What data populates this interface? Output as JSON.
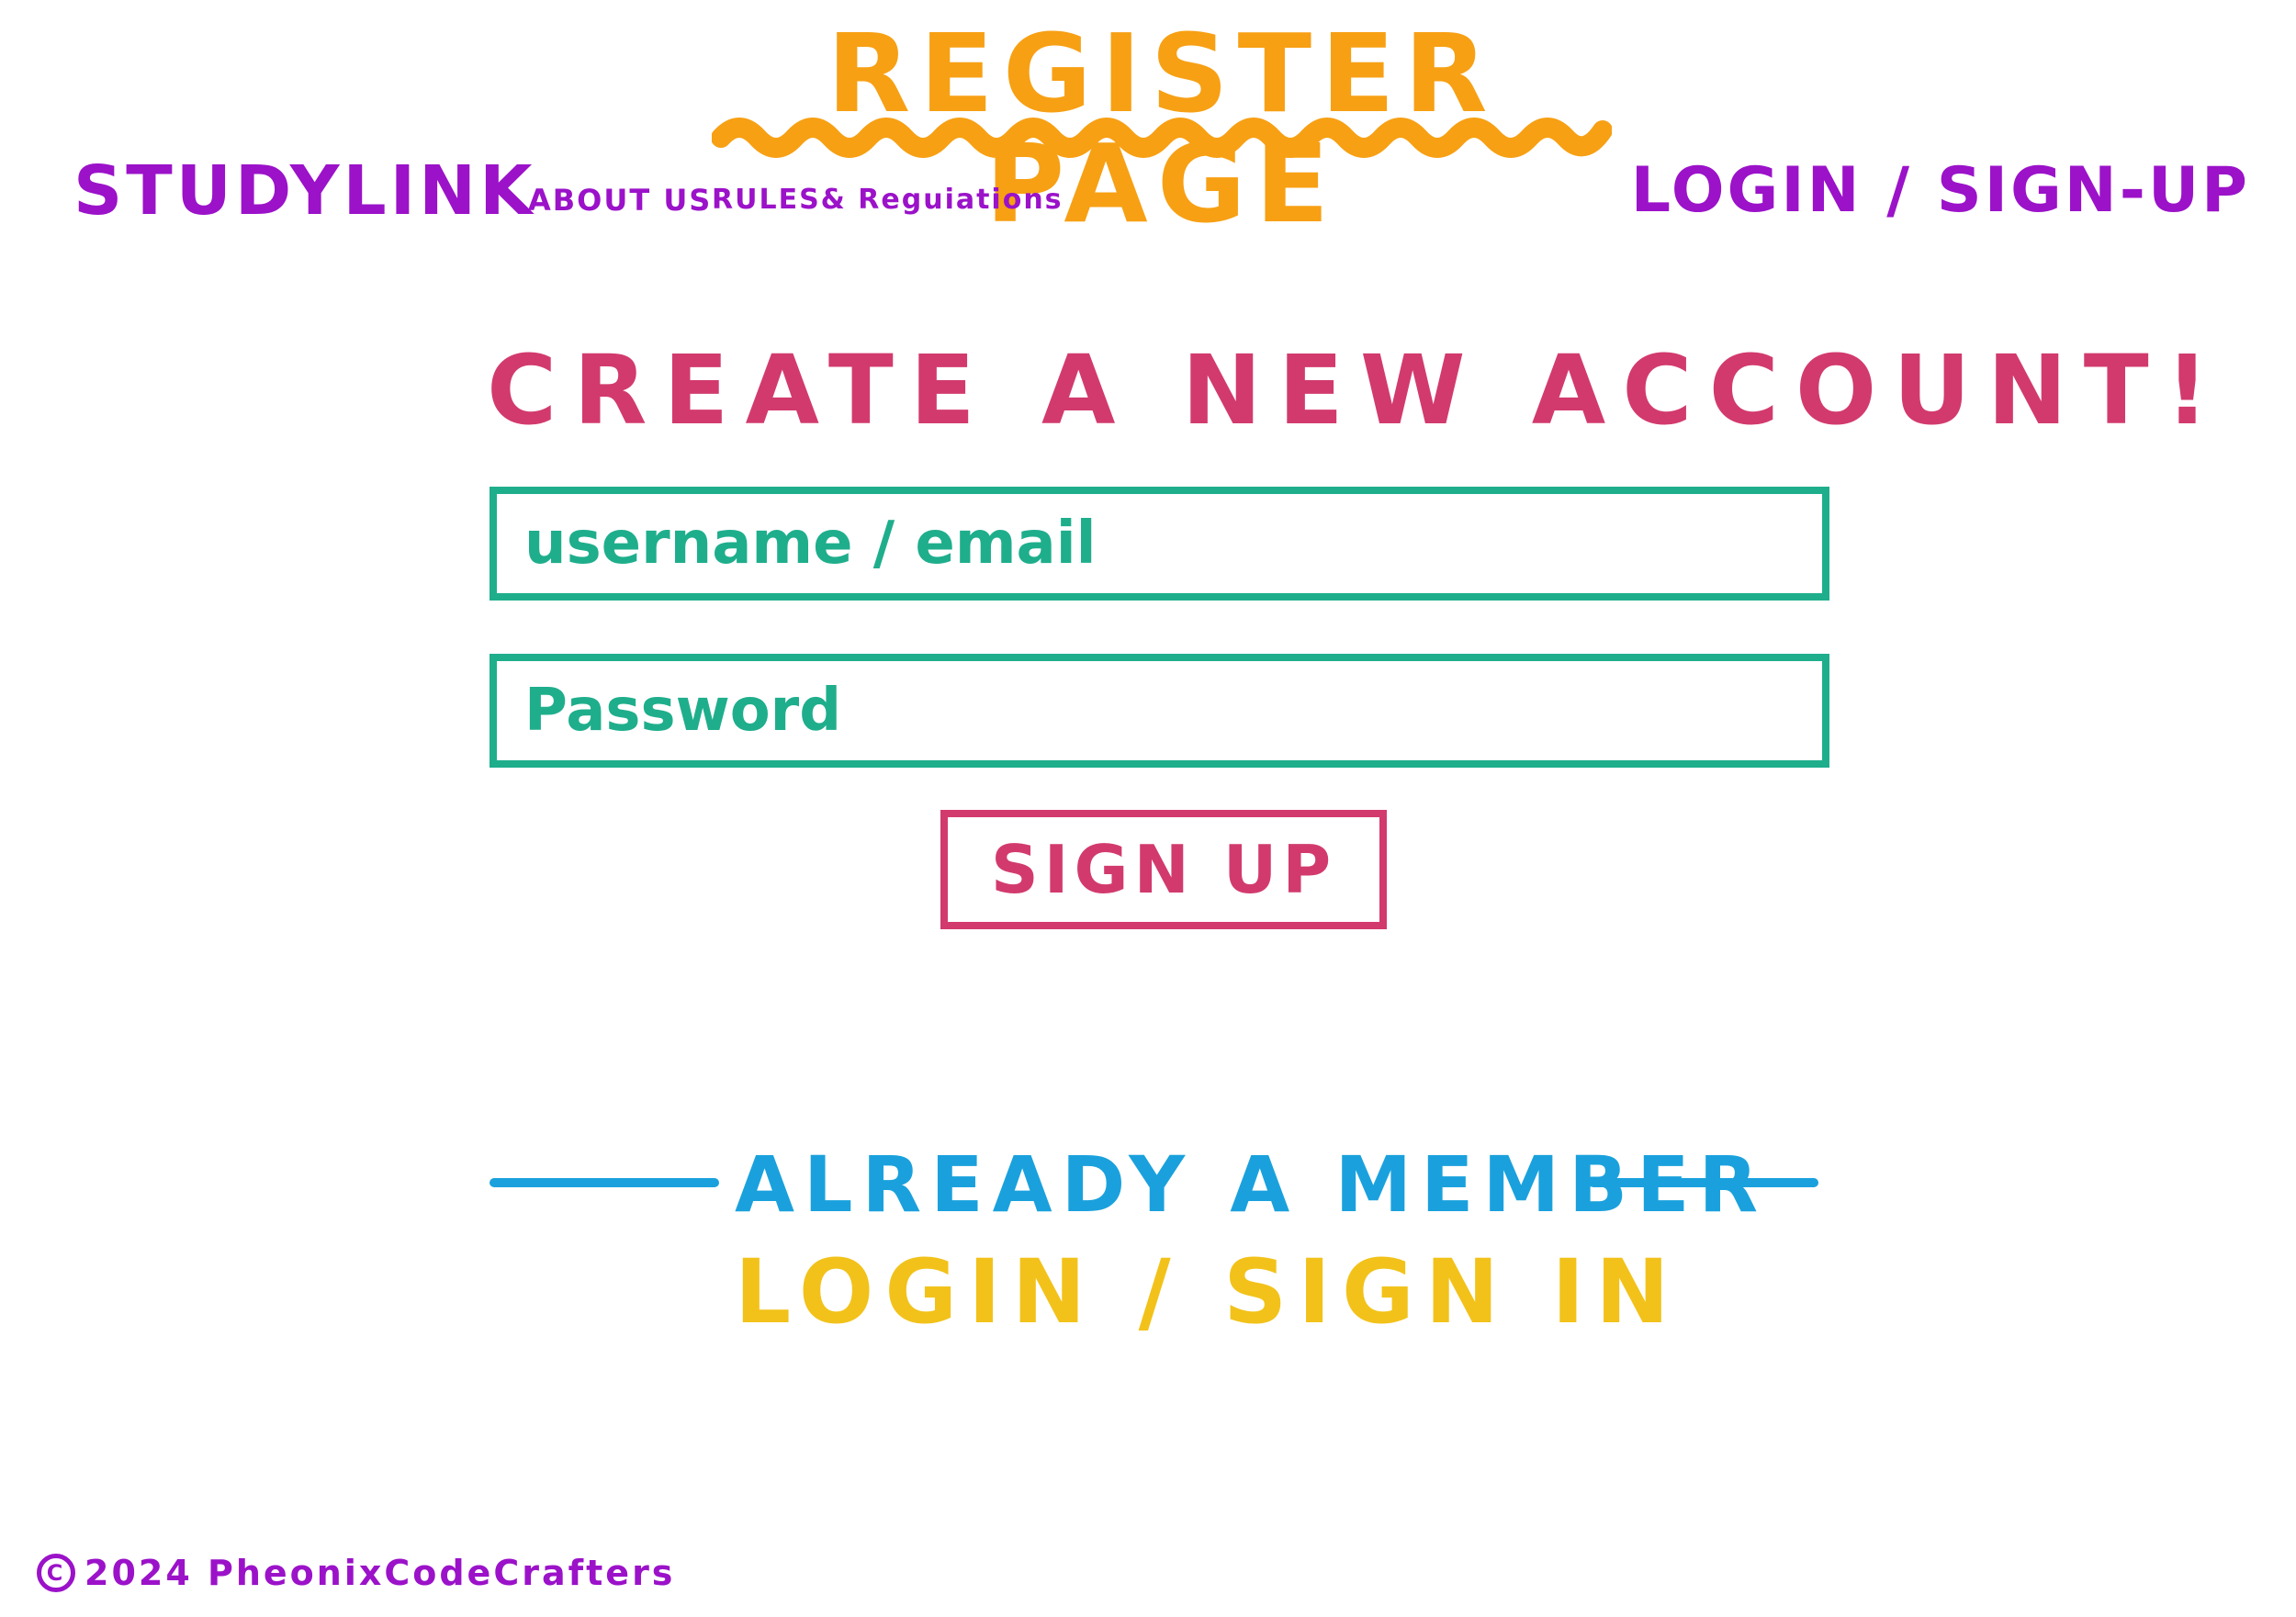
{
  "header": {
    "page_title": "REGISTER PAGE",
    "brand": "STUDYLINK",
    "nav": {
      "about": "ABOUT US",
      "rules": "RULES& Reguiations",
      "auth": "LOGIN / SIGN-UP"
    }
  },
  "form": {
    "heading": "CREATE A NEW ACCOUNT!",
    "username_placeholder": "username / email",
    "password_placeholder": "Password",
    "submit_label": "SIGN UP"
  },
  "member": {
    "prompt": "ALREADY A MEMBER",
    "login_link": "LOGIN / SIGN IN"
  },
  "footer": {
    "copyright_symbol": "C",
    "text": "2024 PheonixCodeCrafters"
  },
  "colors": {
    "title": "#f7a014",
    "nav": "#9b12c9",
    "heading": "#d23a6e",
    "field": "#1fae8c",
    "member": "#1aa1dd",
    "login_link": "#f2c21a"
  },
  "icons": {
    "title_underline": "squiggle-underline",
    "copyright": "copyright-icon"
  }
}
